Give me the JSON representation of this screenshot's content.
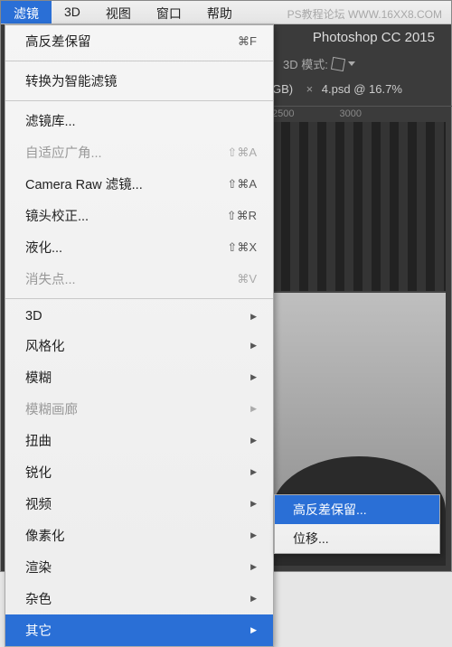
{
  "watermark": "PS教程论坛  WWW.16XX8.COM",
  "menubar": {
    "filter": "滤镜",
    "three_d": "3D",
    "view": "视图",
    "window": "窗口",
    "help": "帮助"
  },
  "background": {
    "app_title": "Photoshop CC 2015",
    "mode_label": "3D 模式:",
    "tab_gb": "GB)",
    "tab_close": "×",
    "tab_name": "4.psd @ 16.7%",
    "ruler_a": "2500",
    "ruler_b": "3000"
  },
  "menu": {
    "last_filter": "高反差保留",
    "last_filter_key": "⌘F",
    "smart": "转换为智能滤镜",
    "gallery": "滤镜库...",
    "adaptive": "自适应广角...",
    "adaptive_key": "⇧⌘A",
    "camera_raw": "Camera Raw 滤镜...",
    "camera_raw_key": "⇧⌘A",
    "lens": "镜头校正...",
    "lens_key": "⇧⌘R",
    "liquify": "液化...",
    "liquify_key": "⇧⌘X",
    "vanish": "消失点...",
    "vanish_key": "⌘V",
    "s_3d": "3D",
    "s_stylize": "风格化",
    "s_blur": "模糊",
    "s_blur_gallery": "模糊画廊",
    "s_distort": "扭曲",
    "s_sharpen": "锐化",
    "s_video": "视频",
    "s_pixelate": "像素化",
    "s_render": "渲染",
    "s_noise": "杂色",
    "s_other": "其它"
  },
  "submenu": {
    "highpass": "高反差保留...",
    "offset": "位移..."
  }
}
